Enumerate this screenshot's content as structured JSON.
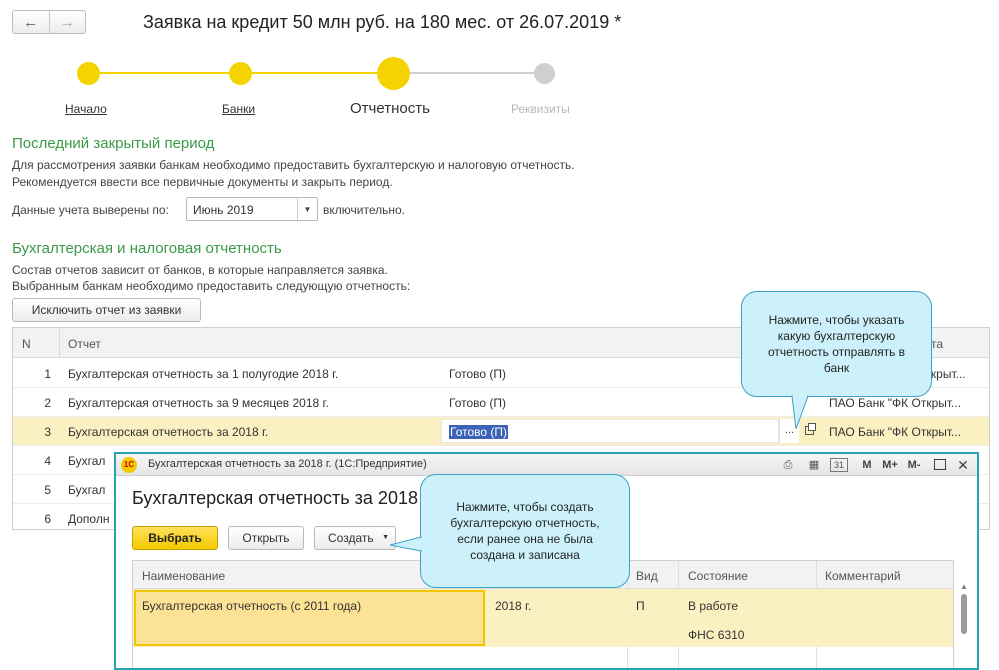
{
  "title": "Заявка на кредит 50 млн руб. на 180 мес. от 26.07.2019 *",
  "nav": {
    "back_icon": "←",
    "forward_icon": "→"
  },
  "steps": [
    {
      "label": "Начало",
      "state": "done"
    },
    {
      "label": "Банки",
      "state": "done"
    },
    {
      "label": "Отчетность",
      "state": "current"
    },
    {
      "label": "Реквизиты",
      "state": "todo"
    }
  ],
  "colors": {
    "accent_yellow": "#f4d300",
    "section_green": "#3a9a46",
    "selection_blue": "#3b62b8",
    "callout_bg": "#cdf1fa",
    "modal_border": "#23a6b0"
  },
  "period_section": {
    "title": "Последний закрытый период",
    "lines": [
      "Для рассмотрения заявки банкам необходимо предоставить бухгалтерскую и налоговую отчетность.",
      "Рекомендуется ввести все первичные документы и закрыть период."
    ],
    "field_label": "Данные учета выверены по:",
    "field_value": "Июнь 2019",
    "field_suffix": "включительно."
  },
  "reports_section": {
    "title": "Бухгалтерская и налоговая отчетность",
    "lines": [
      "Состав отчетов зависит от банков, в которые направляется заявка.",
      "Выбранным банкам необходимо предоставить следующую отчетность:"
    ],
    "exclude_button": "Исключить отчет из заявки"
  },
  "reports_table": {
    "columns": [
      "N",
      "Отчет",
      "та"
    ],
    "rows": [
      {
        "n": "1",
        "report": "Бухгалтерская отчетность за 1 полугодие 2018 г.",
        "status": "Готово (П)",
        "bank": "открыт..."
      },
      {
        "n": "2",
        "report": "Бухгалтерская отчетность за 9 месяцев 2018 г.",
        "status": "Готово (П)",
        "bank": "ПАО Банк \"ФК Открыт..."
      },
      {
        "n": "3",
        "report": "Бухгалтерская отчетность за 2018 г.",
        "status": "Готово (П)",
        "bank": "ПАО Банк \"ФК Открыт..."
      },
      {
        "n": "4",
        "report": "Бухгал"
      },
      {
        "n": "5",
        "report": "Бухгал"
      },
      {
        "n": "6",
        "report": "Дополн"
      }
    ],
    "ellipsis": "..."
  },
  "callout_top": "Нажмите, чтобы указать какую бухгалтерскую отчетность отправлять в банк",
  "callout_modal": "Нажмите, чтобы создать бухгалтерскую отчетность, если ранее она не была создана и записана",
  "modal": {
    "window_title": "Бухгалтерская отчетность за 2018 г.  (1С:Предприятие)",
    "app_icon": "1С",
    "toolbar": {
      "m": "M",
      "m_plus": "M+",
      "m_minus": "M-",
      "calendar": "31"
    },
    "form_title": "Бухгалтерская отчетность за 2018",
    "select_button": "Выбрать",
    "open_button": "Открыть",
    "create_button": "Создать",
    "columns": [
      "Наименование",
      "Вид",
      "Состояние",
      "Комментарий"
    ],
    "row": {
      "name": "Бухгалтерская отчетность (с 2011 года)",
      "period": "2018 г.",
      "kind": "П",
      "state": "В работе",
      "state_sub": "ФНС 6310"
    }
  }
}
